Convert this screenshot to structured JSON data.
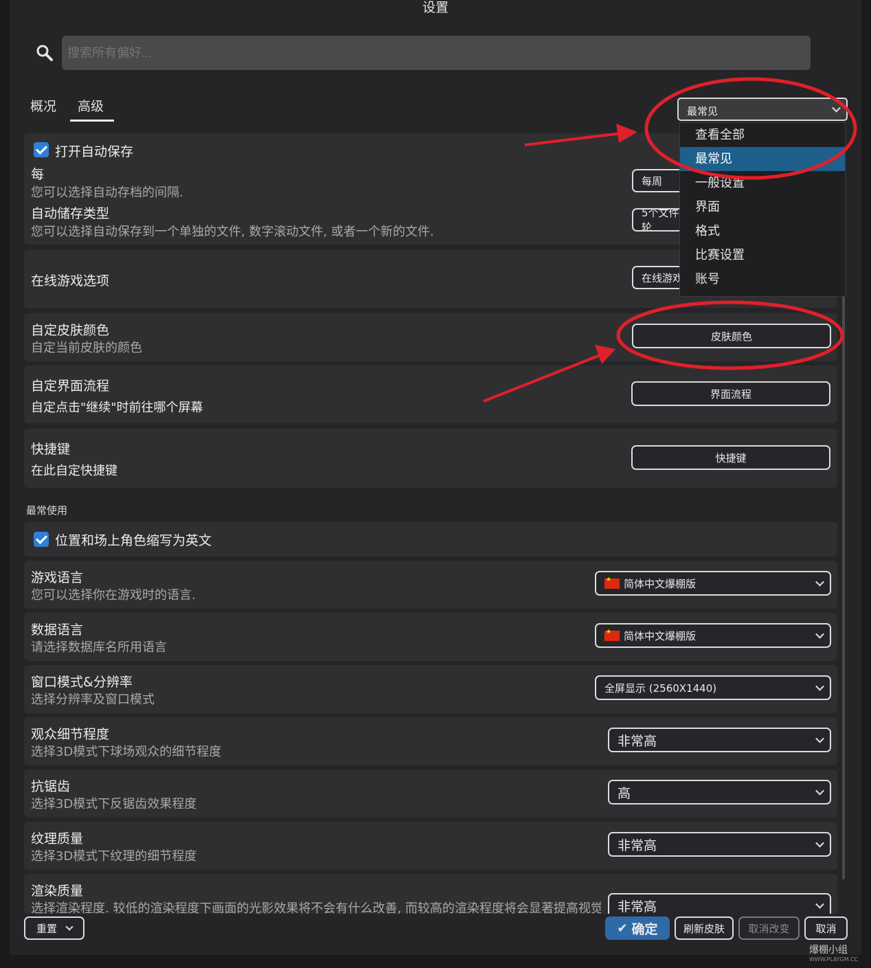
{
  "window": {
    "title": "设置"
  },
  "search": {
    "placeholder": "搜索所有偏好..."
  },
  "tabs": [
    {
      "label": "概况"
    },
    {
      "label": "高级"
    }
  ],
  "filter": {
    "value": "最常见",
    "options": [
      "查看全部",
      "最常见",
      "一般设置",
      "界面",
      "格式",
      "比赛设置",
      "账号"
    ]
  },
  "autosave": {
    "label": "打开自动保存",
    "every_label": "每",
    "every_desc": "您可以选择自动存档的间隔.",
    "every_value": "每周",
    "type_label": "自动储存类型",
    "type_desc": "您可以选择自动保存到一个单独的文件, 数字滚动文件, 或者一个新的文件.",
    "type_value": "5个文件轮"
  },
  "online": {
    "label": "在线游戏选项",
    "button": "在线游戏"
  },
  "skin": {
    "label": "自定皮肤颜色",
    "desc": "自定当前皮肤的颜色",
    "button": "皮肤颜色"
  },
  "flow": {
    "label": "自定界面流程",
    "desc": "自定点击\"继续\"时前往哪个屏幕",
    "button": "界面流程"
  },
  "hotkeys": {
    "label": "快捷键",
    "desc": "在此自定快捷键",
    "button": "快捷键"
  },
  "section_title": "最常使用",
  "abbrev": {
    "label": "位置和场上角色缩写为英文"
  },
  "game_lang": {
    "label": "游戏语言",
    "desc": "您可以选择你在游戏时的语言.",
    "value": "简体中文爆棚版"
  },
  "data_lang": {
    "label": "数据语言",
    "desc": "请选择数据库名所用语言",
    "value": "简体中文爆棚版"
  },
  "window_mode": {
    "label": "窗口模式&分辨率",
    "desc": "选择分辨率及窗口模式",
    "value": "全屏显示 (2560X1440)"
  },
  "crowd": {
    "label": "观众细节程度",
    "desc": "选择3D模式下球场观众的细节程度",
    "value": "非常高"
  },
  "aa": {
    "label": "抗锯齿",
    "desc": "选择3D模式下反锯齿效果程度",
    "value": "高"
  },
  "texture": {
    "label": "纹理质量",
    "desc": "选择3D模式下纹理的细节程度",
    "value": "非常高"
  },
  "render": {
    "label": "渲染质量",
    "desc": "选择渲染程度. 较低的渲染程度下画面的光影效果将不会有什么改善, 而较高的渲染程度将会显著提高视觉",
    "value": "非常高"
  },
  "footer": {
    "reset": "重置",
    "confirm": "确定",
    "refresh_skin": "刷新皮肤",
    "undo": "取消改变",
    "cancel": "取消"
  },
  "watermark": {
    "line1": "爆棚小组",
    "line2": "WWW.PLAYGM.CC"
  },
  "colors": {
    "accent": "#2f7fd6",
    "selected": "#1e5f8c",
    "annotation": "#e0202a"
  }
}
